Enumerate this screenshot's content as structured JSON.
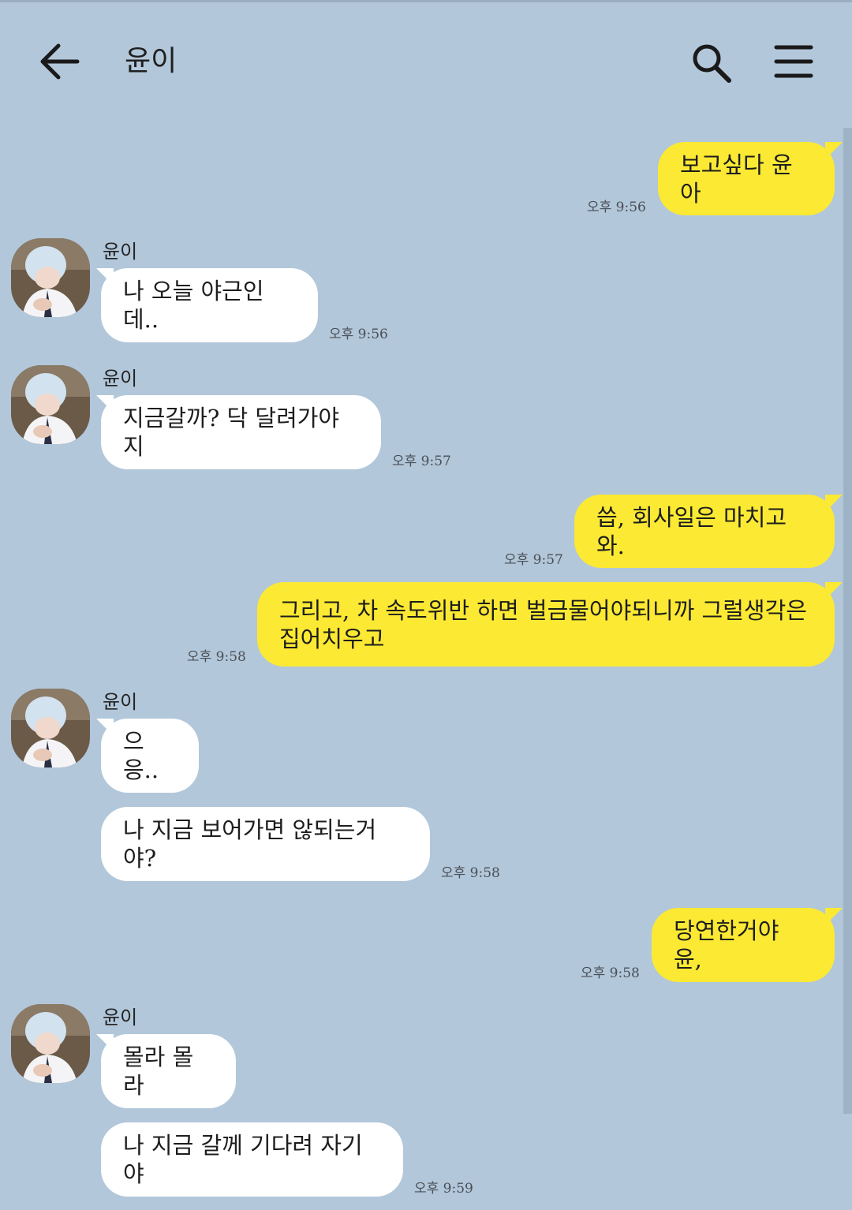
{
  "header": {
    "title": "윤이",
    "back_icon": "arrow-left-icon",
    "search_icon": "search-icon",
    "menu_icon": "hamburger-menu-icon"
  },
  "colors": {
    "background": "#b2c7da",
    "my_bubble": "#fbe933",
    "their_bubble": "#ffffff"
  },
  "messages": [
    {
      "from": "me",
      "text": "보고싶다 윤아",
      "time": "오후 9:56"
    },
    {
      "from": "them",
      "sender": "윤이",
      "text": "나 오늘 야근인데..",
      "time": "오후 9:56"
    },
    {
      "from": "them",
      "sender": "윤이",
      "text": "지금갈까? 닥 달려가야지",
      "time": "오후 9:57"
    },
    {
      "from": "me",
      "text": "씁, 회사일은 마치고와.",
      "time": "오후 9:57"
    },
    {
      "from": "me",
      "text_line1": "그리고, 차 속도위반 하면 벌금물어야되니까 그럴생각은",
      "text_line2": "집어치우고",
      "time": "오후 9:58"
    },
    {
      "from": "them",
      "sender": "윤이",
      "text": "으응..",
      "time": ""
    },
    {
      "from": "them",
      "text": "나 지금 보어가면 않되는거야?",
      "time": "오후 9:58"
    },
    {
      "from": "me",
      "text": "당연한거야 윤,",
      "time": "오후 9:58"
    },
    {
      "from": "them",
      "sender": "윤이",
      "text": "몰라 몰라",
      "time": ""
    },
    {
      "from": "them",
      "text": "나 지금 갈께 기다려 자기야",
      "time": "오후 9:59"
    }
  ]
}
